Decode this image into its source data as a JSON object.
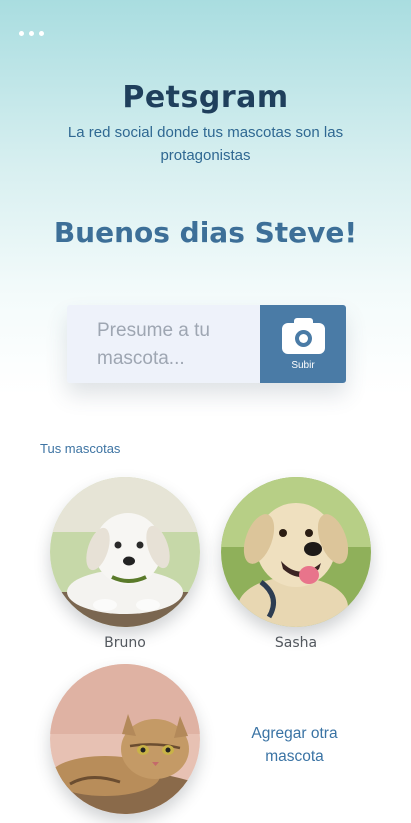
{
  "header": {
    "menu_icon": "more-horizontal-icon",
    "app_title": "Petsgram",
    "tagline": "La red social donde tus mascotas son las protagonistas"
  },
  "greeting": "Buenos dias Steve!",
  "composer": {
    "placeholder": "Presume a tu mascota...",
    "upload_icon": "camera-icon",
    "upload_label": "Subir"
  },
  "pets_section": {
    "heading": "Tus mascotas",
    "pets": [
      {
        "name": "Bruno"
      },
      {
        "name": "Sasha"
      },
      {
        "name": ""
      }
    ],
    "add_label": "Agregar otra mascota"
  },
  "colors": {
    "brand_dark": "#1f3f5c",
    "accent": "#4a7ba6",
    "gradient_top": "#a9dde0"
  }
}
